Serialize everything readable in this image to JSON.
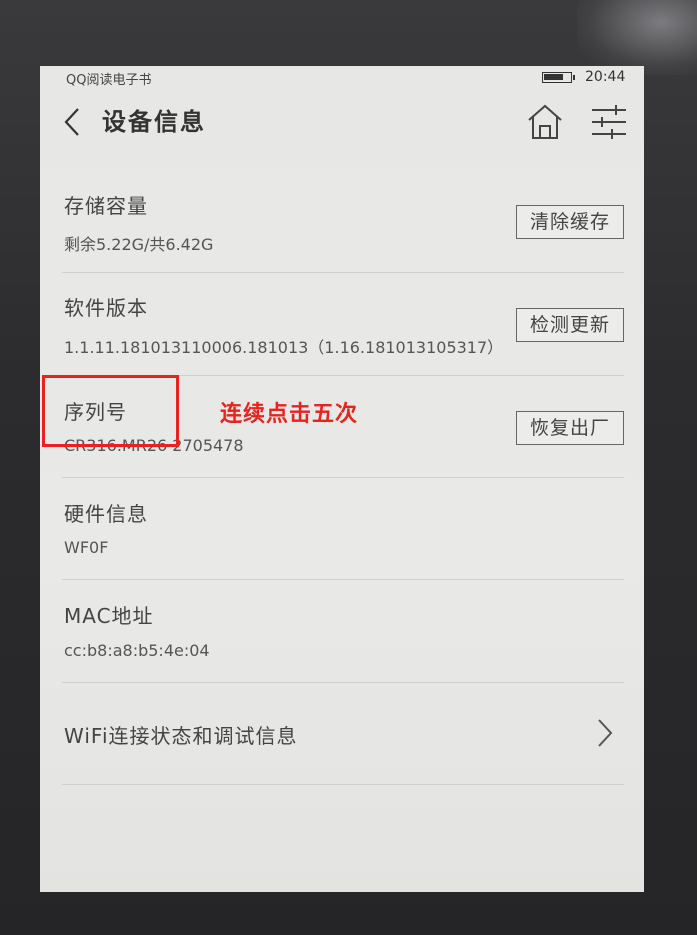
{
  "statusbar": {
    "app_name": "QQ阅读电子书",
    "time": "20:44"
  },
  "header": {
    "title": "设备信息",
    "icons": [
      "back-icon",
      "home-icon",
      "settings-sliders-icon"
    ]
  },
  "rows": [
    {
      "label": "存储容量",
      "value": "剩余5.22G/共6.42G",
      "button": "清除缓存"
    },
    {
      "label": "软件版本",
      "value": "1.1.11.181013110006.181013（1.16.181013105317）",
      "button": "检测更新"
    },
    {
      "label": "序列号",
      "value": "CR316.MR26 2705478",
      "button": "恢复出厂"
    },
    {
      "label": "硬件信息",
      "value": "WF0F"
    },
    {
      "label": "MAC地址",
      "value": "cc:b8:a8:b5:4e:04"
    },
    {
      "label": "WiFi连接状态和调试信息",
      "icon": "chevron-right-icon"
    }
  ],
  "annotation": {
    "text": "连续点击五次",
    "color": "#e8221c"
  },
  "colors": {
    "screen_bg": "#e8e8e6",
    "text": "#444444",
    "annotation": "#e8221c"
  }
}
